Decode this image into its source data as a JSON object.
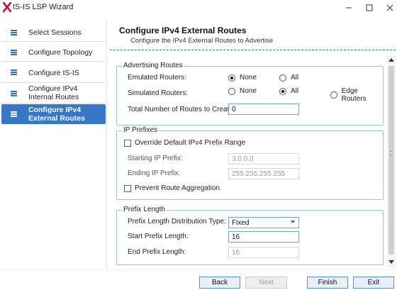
{
  "window": {
    "title": "IS-IS LSP Wizard",
    "logo_color": "#c8102e"
  },
  "sidebar": {
    "items": [
      {
        "label": "Select Sessions",
        "active": false
      },
      {
        "label": "Configure Topology",
        "active": false
      },
      {
        "label": "Configure IS-IS",
        "active": false
      },
      {
        "label": "Configure IPv4 Internal Routes",
        "active": false
      },
      {
        "label": "Configure IPv4 External Routes",
        "active": true
      }
    ],
    "active_color": "#3876c7"
  },
  "header": {
    "title": "Configure IPv4 External Routes",
    "subtitle": "Configure the IPv4 External Routes to Advertise"
  },
  "advertising_routes": {
    "legend": "Advertising Routes",
    "emulated_label": "Emulated Routers:",
    "emulated_options": {
      "none": "None",
      "all": "All",
      "selected": "None"
    },
    "simulated_label": "Simulated Routers:",
    "simulated_options": {
      "none": "None",
      "all": "All",
      "edge": "Edge Routers",
      "selected": "All"
    },
    "total_routes_label": "Total Number of Routes to Create:",
    "total_routes_value": "0"
  },
  "ip_prefixes": {
    "legend": "IP Prefixes",
    "override_label": "Override Default IPv4 Prefix Range",
    "override_checked": false,
    "start_label": "Starting IP Prefix:",
    "start_value": "3.0.0.0",
    "end_label": "Ending IP Prefix:",
    "end_value": "255.255.255.255",
    "prevent_label": "Prevent Route Aggregation",
    "prevent_checked": false
  },
  "prefix_length": {
    "legend": "Prefix Length",
    "distribution_label": "Prefix Length Distribution Type:",
    "distribution_value": "Fixed",
    "start_label": "Start Prefix Length:",
    "start_value": "16",
    "end_label": "End Prefix Length:",
    "end_value": "16"
  },
  "footer": {
    "back": "Back",
    "next": "Next",
    "finish": "Finish",
    "exit": "Exit"
  }
}
